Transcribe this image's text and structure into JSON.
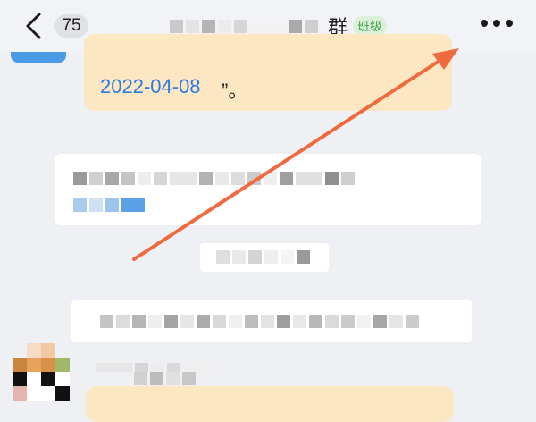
{
  "header": {
    "unread_count": "75",
    "title_visible": "群",
    "class_tag": "班级",
    "back_icon": "chevron-left-icon",
    "more_icon": "more-horizontal-icon"
  },
  "messages": {
    "top_bubble_date": "2022-04-08",
    "top_bubble_suffix": "”。"
  },
  "colors": {
    "accent_link": "#2b7de0",
    "bubble_bg": "#fde7c2",
    "tag_green": "#3fa34d",
    "arrow": "#ef6a3f"
  },
  "annotation": {
    "type": "arrow"
  }
}
